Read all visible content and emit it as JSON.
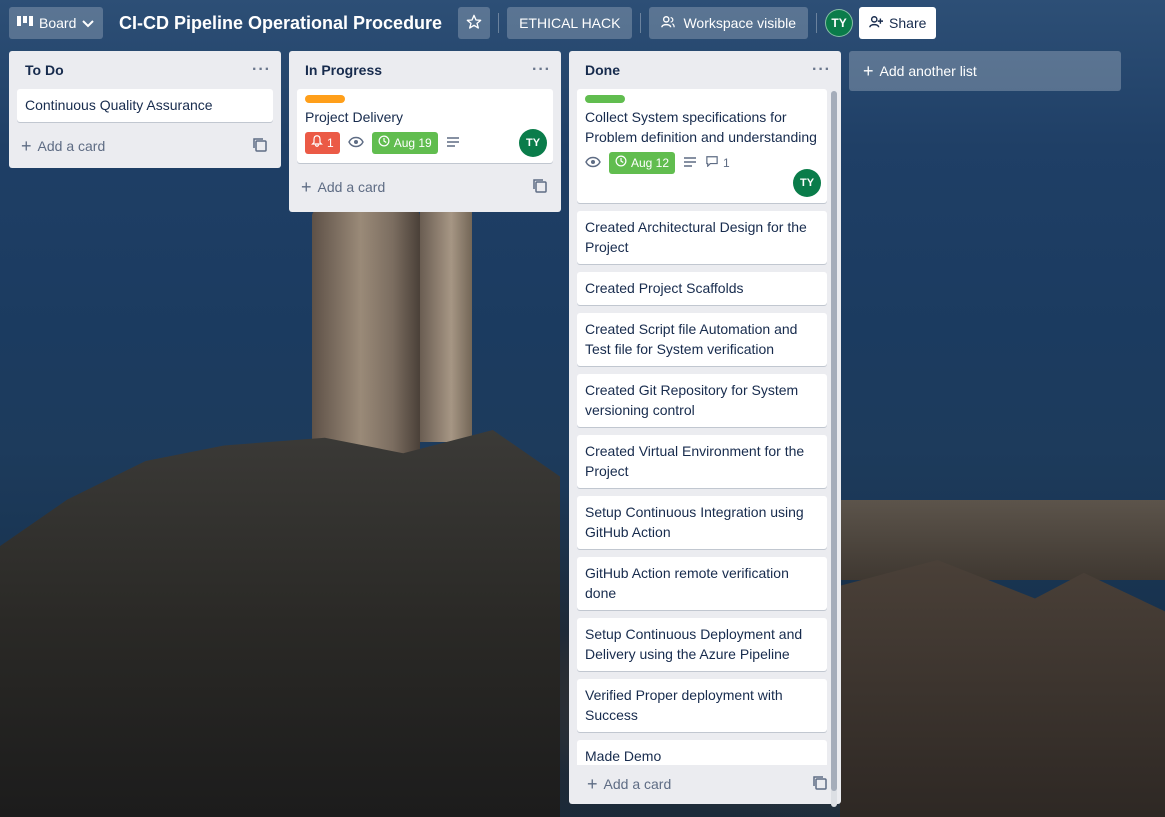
{
  "header": {
    "board_button_label": "Board",
    "board_title": "CI-CD Pipeline Operational Procedure",
    "workspace_name": "ETHICAL HACK",
    "visibility_label": "Workspace visible",
    "member_initials": "TY",
    "share_label": "Share"
  },
  "lists": {
    "todo": {
      "title": "To Do",
      "cards": [
        {
          "title": "Continuous Quality Assurance"
        }
      ],
      "add_card_label": "Add a card"
    },
    "in_progress": {
      "title": "In Progress",
      "cards": [
        {
          "label_color": "#ff9f1a",
          "title": "Project Delivery",
          "notification_count": "1",
          "due_date": "Aug 19",
          "member": "TY"
        }
      ],
      "add_card_label": "Add a card"
    },
    "done": {
      "title": "Done",
      "cards": [
        {
          "label_color": "#61bd4f",
          "title": "Collect System specifications for Problem definition and understanding",
          "due_date": "Aug 12",
          "comment_count": "1",
          "member": "TY"
        },
        {
          "title": "Created Architectural Design for the Project"
        },
        {
          "title": "Created Project Scaffolds"
        },
        {
          "title": "Created Script file Automation and Test file for System verification"
        },
        {
          "title": "Created Git Repository for System versioning control"
        },
        {
          "title": "Created Virtual Environment for the Project"
        },
        {
          "title": "Setup Continuous Integration using GitHub Action"
        },
        {
          "title": "GitHub Action remote verification done"
        },
        {
          "title": "Setup Continuous Deployment and Delivery using the Azure Pipeline"
        },
        {
          "title": "Verified Proper deployment with Success"
        },
        {
          "title": "Made Demo"
        }
      ],
      "add_card_label": "Add a card"
    }
  },
  "add_list_label": "Add another list",
  "colors": {
    "member_avatar": "#0a7c4a",
    "due_badge": "#61bd4f",
    "notification_badge": "#eb5a46",
    "orange_label": "#ff9f1a",
    "green_label": "#61bd4f"
  }
}
